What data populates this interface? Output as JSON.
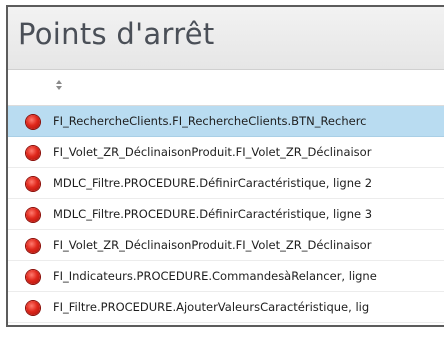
{
  "window": {
    "title": "Points d'arrêt"
  },
  "list": {
    "sort_icon": "sort-updown-icon",
    "breakpoint_color": "#e0281c",
    "selected_color": "#b9dcf1",
    "items": [
      {
        "label": "FI_RechercheClients.FI_RechercheClients.BTN_Recherc",
        "selected": true
      },
      {
        "label": "FI_Volet_ZR_DéclinaisonProduit.FI_Volet_ZR_Déclinaisor",
        "selected": false
      },
      {
        "label": "MDLC_Filtre.PROCEDURE.DéfinirCaractéristique, ligne 2",
        "selected": false
      },
      {
        "label": "MDLC_Filtre.PROCEDURE.DéfinirCaractéristique, ligne 3",
        "selected": false
      },
      {
        "label": "FI_Volet_ZR_DéclinaisonProduit.FI_Volet_ZR_Déclinaisor",
        "selected": false
      },
      {
        "label": "FI_Indicateurs.PROCEDURE.CommandesàRelancer, ligne",
        "selected": false
      },
      {
        "label": "FI_Filtre.PROCEDURE.AjouterValeursCaractéristique, lig",
        "selected": false
      }
    ]
  }
}
